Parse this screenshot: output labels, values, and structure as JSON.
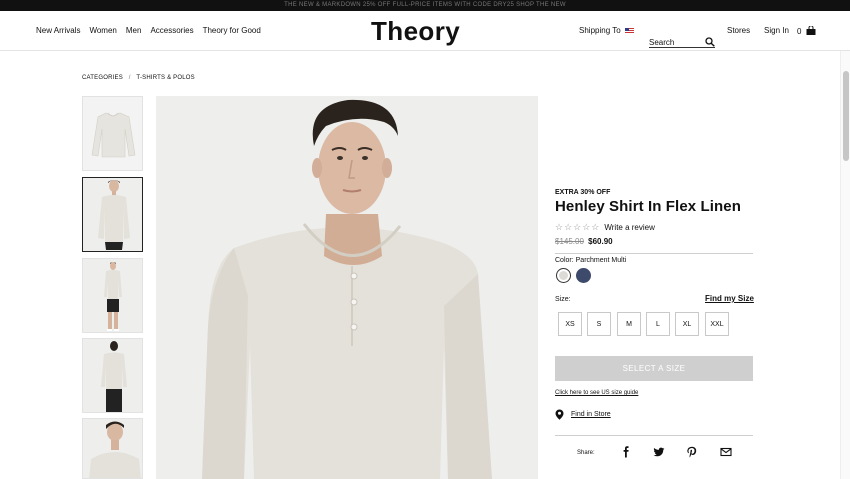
{
  "promo": {
    "text": "THE NEW & MARKDOWN 25% OFF FULL-PRICE ITEMS WITH CODE DRY25 SHOP THE NEW"
  },
  "nav": {
    "items": [
      "New Arrivals",
      "Women",
      "Men",
      "Accessories",
      "Theory for Good"
    ],
    "logo": "Theory",
    "shipping_label": "Shipping To",
    "search_label": "Search",
    "stores": "Stores",
    "sign_in": "Sign In",
    "bag_count": "0"
  },
  "breadcrumb": {
    "root": "CATEGORIES",
    "sep": "/",
    "current": "T-SHIRTS & POLOS"
  },
  "product": {
    "eyebrow": "EXTRA 30% OFF",
    "title": "Henley Shirt In Flex Linen",
    "stars": "☆☆☆☆☆",
    "review_link": "Write a review",
    "old_price": "$145.00",
    "new_price": "$60.90",
    "color_label": "Color:",
    "color_name": "Parchment Multi",
    "swatches": [
      {
        "name": "Parchment Multi",
        "color": "#dcdbd6"
      },
      {
        "name": "Navy",
        "color": "#3d4a6b"
      }
    ],
    "size_label": "Size:",
    "size_guide": "Find my Size",
    "sizes": [
      "XS",
      "S",
      "M",
      "L",
      "XL",
      "XXL"
    ],
    "select_button": "SELECT A SIZE",
    "us_size_guide": "Click here to see US size guide",
    "find_in_store": "Find in Store",
    "share_label": "Share:"
  },
  "colors": {
    "accent": "#111111",
    "button_disabled": "#cfcfcf",
    "shirt": "#e4e1da"
  }
}
